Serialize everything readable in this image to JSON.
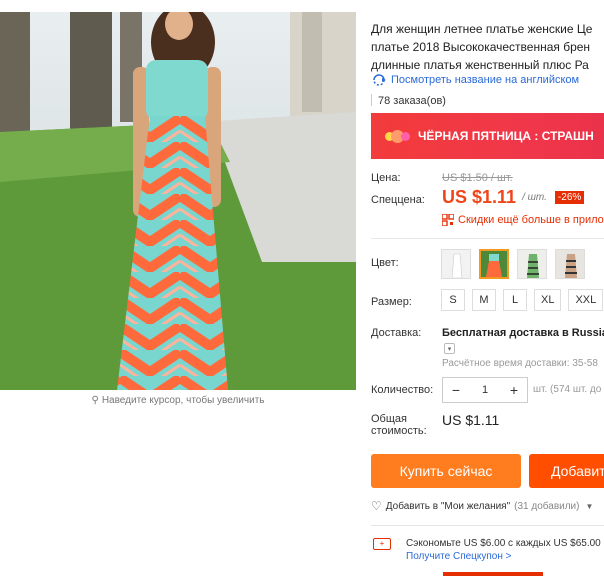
{
  "product": {
    "title": "Для женщин летнее платье женские Це\nплатье 2018 Высококачественная брен\nдлинные платья женственный плюс Ра",
    "translate_link": "Посмотреть название на английском",
    "orders": "78 заказа(ов)",
    "zoom_hint": "Наведите курсор, чтобы увеличить"
  },
  "banner": {
    "text": "ЧЁРНАЯ ПЯТНИЦА : СТРАШН"
  },
  "pricing": {
    "price_label": "Цена:",
    "old_price": "US $1.50 / шт.",
    "special_label": "Спеццена:",
    "new_price": "US $1.11",
    "unit": "/ шт.",
    "discount": "-26%",
    "app_discount": "Скидки ещё больше в приложе"
  },
  "options": {
    "color_label": "Цвет:",
    "colors": [
      "white",
      "multi-green-selected",
      "striped-green",
      "striped-black"
    ],
    "size_label": "Размер:",
    "sizes": [
      "S",
      "M",
      "L",
      "XL",
      "XXL"
    ]
  },
  "shipping": {
    "label": "Доставка:",
    "main": "Бесплатная доставка в Russian F",
    "time": "Расчётное время доставки: 35-58"
  },
  "quantity": {
    "label": "Количество:",
    "minus": "−",
    "value": "1",
    "plus": "+",
    "note": "шт. (574 шт. до"
  },
  "total": {
    "label": "Общая стоимость:",
    "value": "US $1.11"
  },
  "actions": {
    "buy_now": "Купить сейчас",
    "add_to_cart": "Добавит",
    "wishlist": "Добавить в \"Мои желания\"",
    "wishlist_count": "(31 добавили)"
  },
  "coupon": {
    "text": "Сэкономьте US $6.00 с каждых US $65.00",
    "link": "Получите Спецкупон >"
  },
  "colors": {
    "accent_orange": "#ff7d1f",
    "accent_red": "#e62e04",
    "price_red": "#f0441b",
    "link_blue": "#2a6ad8"
  }
}
